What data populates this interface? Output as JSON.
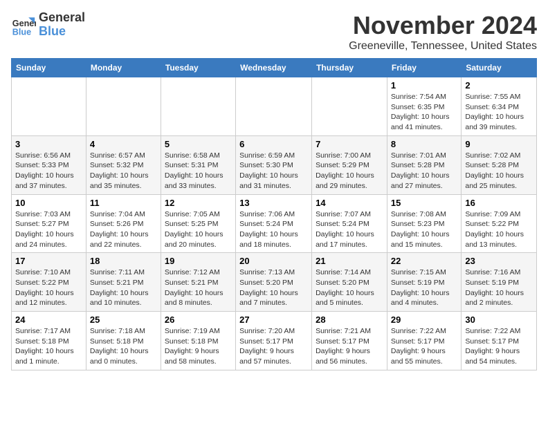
{
  "logo": {
    "line1": "General",
    "line2": "Blue"
  },
  "title": "November 2024",
  "location": "Greeneville, Tennessee, United States",
  "weekdays": [
    "Sunday",
    "Monday",
    "Tuesday",
    "Wednesday",
    "Thursday",
    "Friday",
    "Saturday"
  ],
  "weeks": [
    [
      {
        "day": "",
        "info": ""
      },
      {
        "day": "",
        "info": ""
      },
      {
        "day": "",
        "info": ""
      },
      {
        "day": "",
        "info": ""
      },
      {
        "day": "",
        "info": ""
      },
      {
        "day": "1",
        "info": "Sunrise: 7:54 AM\nSunset: 6:35 PM\nDaylight: 10 hours\nand 41 minutes."
      },
      {
        "day": "2",
        "info": "Sunrise: 7:55 AM\nSunset: 6:34 PM\nDaylight: 10 hours\nand 39 minutes."
      }
    ],
    [
      {
        "day": "3",
        "info": "Sunrise: 6:56 AM\nSunset: 5:33 PM\nDaylight: 10 hours\nand 37 minutes."
      },
      {
        "day": "4",
        "info": "Sunrise: 6:57 AM\nSunset: 5:32 PM\nDaylight: 10 hours\nand 35 minutes."
      },
      {
        "day": "5",
        "info": "Sunrise: 6:58 AM\nSunset: 5:31 PM\nDaylight: 10 hours\nand 33 minutes."
      },
      {
        "day": "6",
        "info": "Sunrise: 6:59 AM\nSunset: 5:30 PM\nDaylight: 10 hours\nand 31 minutes."
      },
      {
        "day": "7",
        "info": "Sunrise: 7:00 AM\nSunset: 5:29 PM\nDaylight: 10 hours\nand 29 minutes."
      },
      {
        "day": "8",
        "info": "Sunrise: 7:01 AM\nSunset: 5:28 PM\nDaylight: 10 hours\nand 27 minutes."
      },
      {
        "day": "9",
        "info": "Sunrise: 7:02 AM\nSunset: 5:28 PM\nDaylight: 10 hours\nand 25 minutes."
      }
    ],
    [
      {
        "day": "10",
        "info": "Sunrise: 7:03 AM\nSunset: 5:27 PM\nDaylight: 10 hours\nand 24 minutes."
      },
      {
        "day": "11",
        "info": "Sunrise: 7:04 AM\nSunset: 5:26 PM\nDaylight: 10 hours\nand 22 minutes."
      },
      {
        "day": "12",
        "info": "Sunrise: 7:05 AM\nSunset: 5:25 PM\nDaylight: 10 hours\nand 20 minutes."
      },
      {
        "day": "13",
        "info": "Sunrise: 7:06 AM\nSunset: 5:24 PM\nDaylight: 10 hours\nand 18 minutes."
      },
      {
        "day": "14",
        "info": "Sunrise: 7:07 AM\nSunset: 5:24 PM\nDaylight: 10 hours\nand 17 minutes."
      },
      {
        "day": "15",
        "info": "Sunrise: 7:08 AM\nSunset: 5:23 PM\nDaylight: 10 hours\nand 15 minutes."
      },
      {
        "day": "16",
        "info": "Sunrise: 7:09 AM\nSunset: 5:22 PM\nDaylight: 10 hours\nand 13 minutes."
      }
    ],
    [
      {
        "day": "17",
        "info": "Sunrise: 7:10 AM\nSunset: 5:22 PM\nDaylight: 10 hours\nand 12 minutes."
      },
      {
        "day": "18",
        "info": "Sunrise: 7:11 AM\nSunset: 5:21 PM\nDaylight: 10 hours\nand 10 minutes."
      },
      {
        "day": "19",
        "info": "Sunrise: 7:12 AM\nSunset: 5:21 PM\nDaylight: 10 hours\nand 8 minutes."
      },
      {
        "day": "20",
        "info": "Sunrise: 7:13 AM\nSunset: 5:20 PM\nDaylight: 10 hours\nand 7 minutes."
      },
      {
        "day": "21",
        "info": "Sunrise: 7:14 AM\nSunset: 5:20 PM\nDaylight: 10 hours\nand 5 minutes."
      },
      {
        "day": "22",
        "info": "Sunrise: 7:15 AM\nSunset: 5:19 PM\nDaylight: 10 hours\nand 4 minutes."
      },
      {
        "day": "23",
        "info": "Sunrise: 7:16 AM\nSunset: 5:19 PM\nDaylight: 10 hours\nand 2 minutes."
      }
    ],
    [
      {
        "day": "24",
        "info": "Sunrise: 7:17 AM\nSunset: 5:18 PM\nDaylight: 10 hours\nand 1 minute."
      },
      {
        "day": "25",
        "info": "Sunrise: 7:18 AM\nSunset: 5:18 PM\nDaylight: 10 hours\nand 0 minutes."
      },
      {
        "day": "26",
        "info": "Sunrise: 7:19 AM\nSunset: 5:18 PM\nDaylight: 9 hours\nand 58 minutes."
      },
      {
        "day": "27",
        "info": "Sunrise: 7:20 AM\nSunset: 5:17 PM\nDaylight: 9 hours\nand 57 minutes."
      },
      {
        "day": "28",
        "info": "Sunrise: 7:21 AM\nSunset: 5:17 PM\nDaylight: 9 hours\nand 56 minutes."
      },
      {
        "day": "29",
        "info": "Sunrise: 7:22 AM\nSunset: 5:17 PM\nDaylight: 9 hours\nand 55 minutes."
      },
      {
        "day": "30",
        "info": "Sunrise: 7:22 AM\nSunset: 5:17 PM\nDaylight: 9 hours\nand 54 minutes."
      }
    ]
  ]
}
